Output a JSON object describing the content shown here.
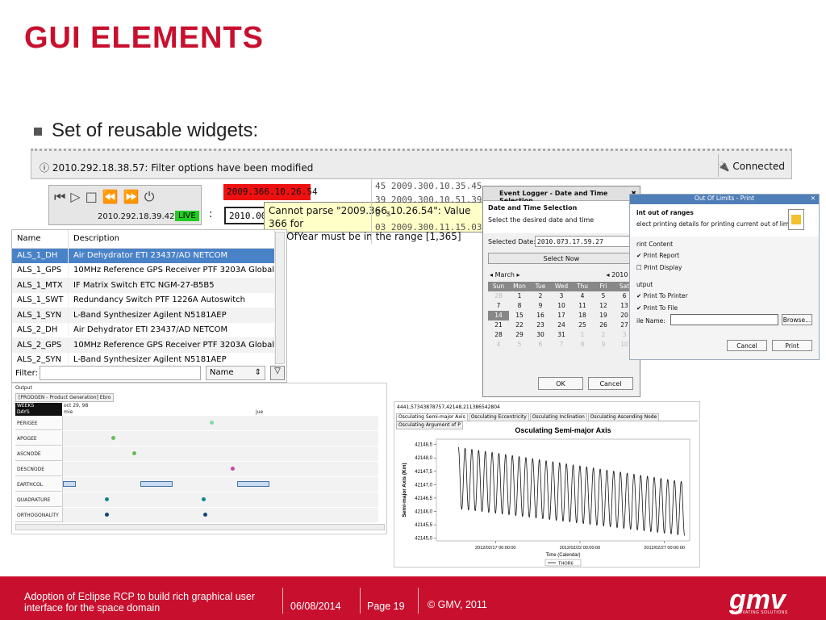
{
  "slide": {
    "title": "GUI ELEMENTS",
    "bullet": "Set of reusable widgets:"
  },
  "statusbar": {
    "message": "2010.292.18.38.57: Filter options have been modified",
    "connection": "Connected"
  },
  "player": {
    "timestamp": "2010.292.18.39.42",
    "live_label": "LIVE"
  },
  "date_widget": {
    "error_value": "2009.366.10.26.54",
    "input_value": "2010.001",
    "tooltip_line1": "Cannot parse \"2009.366.10.26.54\": Value 366 for",
    "tooltip_line2": "dayOfYear must be in the range [1,365]"
  },
  "log_list": [
    {
      "id": "45",
      "time": "2009.300.10.35.45"
    },
    {
      "id": "39",
      "time": "2009.300.10.51.39"
    },
    {
      "id": "0",
      "time": "s"
    },
    {
      "id": "03",
      "time": "2009.300.11.15.03"
    }
  ],
  "table": {
    "columns": [
      "Name",
      "Description"
    ],
    "rows": [
      {
        "name": "ALS_1_DH",
        "desc": "Air Dehydrator ETI 23437/AD NETCOM"
      },
      {
        "name": "ALS_1_GPS",
        "desc": "10MHz Reference GPS Receiver PTF 3203A Global"
      },
      {
        "name": "ALS_1_MTX",
        "desc": "IF Matrix Switch ETC NGM-27-B5B5"
      },
      {
        "name": "ALS_1_SWT",
        "desc": "Redundancy Switch PTF 1226A Autoswitch"
      },
      {
        "name": "ALS_1_SYN",
        "desc": "L-Band Synthesizer Agilent N5181AEP"
      },
      {
        "name": "ALS_2_DH",
        "desc": "Air Dehydrator ETI 23437/AD NETCOM"
      },
      {
        "name": "ALS_2_GPS",
        "desc": "10MHz Reference GPS Receiver PTF 3203A Global"
      },
      {
        "name": "ALS_2_SYN",
        "desc": "L-Band Synthesizer Agilent N5181AEP"
      }
    ],
    "filter_label": "Filter:",
    "filter_value": "",
    "filter_field": "Name"
  },
  "timeline": {
    "output_label": "Output",
    "tab_label": "[PRODGEN - Product Generation] Ebro",
    "weeks_label": "WEEKS",
    "weeks_value": "oct 29, 98",
    "days_label": "DAYS",
    "days_value1": "mie",
    "days_value2": "jue",
    "rows": [
      "PERIGEE",
      "APOGEE",
      "ASCNODE",
      "DESCNODE",
      "EARTHCOL",
      "QUADRATURE",
      "ORTHOGONALITY"
    ]
  },
  "event_dialog": {
    "window_title": "Event Logger - Date and Time Selection",
    "header_title": "Date and Time Selection",
    "header_sub": "Select the desired date and time",
    "selected_label": "Selected Date:",
    "selected_value": "2010.073.17.59.27",
    "select_now": "Select Now",
    "month": "March",
    "year": "2010",
    "weekdays": [
      "Sun",
      "Mon",
      "Tue",
      "Wed",
      "Thu",
      "Fri",
      "Sat"
    ],
    "weeks": [
      [
        "28",
        "1",
        "2",
        "3",
        "4",
        "5",
        "6"
      ],
      [
        "7",
        "8",
        "9",
        "10",
        "11",
        "12",
        "13"
      ],
      [
        "14",
        "15",
        "16",
        "17",
        "18",
        "19",
        "20"
      ],
      [
        "21",
        "22",
        "23",
        "24",
        "25",
        "26",
        "27"
      ],
      [
        "28",
        "29",
        "30",
        "31",
        "1",
        "2",
        "3"
      ],
      [
        "4",
        "5",
        "6",
        "7",
        "8",
        "9",
        "10"
      ]
    ],
    "ok": "OK",
    "cancel": "Cancel"
  },
  "print_dialog": {
    "window_title": "Out Of Limits - Print",
    "header_title": "int out of ranges",
    "header_sub": "elect printing details for printing current out of limits",
    "group_content": "rint Content",
    "print_report": "Print Report",
    "print_display": "Print Display",
    "group_output": "utput",
    "print_to_printer": "Print To Printer",
    "print_to_file": "Print To File",
    "file_name_label": "ile Name:",
    "browse": "Browse...",
    "cancel": "Cancel",
    "print": "Print"
  },
  "chart_data": {
    "type": "line",
    "header_text": "4441,57343878757,42148,211386542804",
    "tabs": [
      "Osculating Semi-major Axis",
      "Osculating Eccentricity",
      "Osculating Inclination",
      "Osculating Ascending Node",
      "Osculating Argument of P"
    ],
    "title": "Osculating Semi-major Axis",
    "ylabel": "Semi-major Axis (Km)",
    "xlabel": "Time (Calendar)",
    "yticks": [
      "42148,5",
      "42148,0",
      "42147,5",
      "42147,0",
      "42146,5",
      "42146,0",
      "42145,5",
      "42145,0"
    ],
    "xticks": [
      "2012/02/17 00:00:00",
      "2012/02/22 00:00:00",
      "2012/02/27 00:00:00"
    ],
    "ylim": [
      42144.9,
      42148.7
    ],
    "series": [
      {
        "name": "THOR6",
        "color": "#111111"
      }
    ],
    "x_start": "2012/02/13 12:00:00",
    "x_end": "2012/02/28 12:00:00",
    "oscillation_period_days": 0.4,
    "envelope": {
      "max_start": 42148.4,
      "max_end": 42147.1,
      "min_start": 42146.1,
      "min_end": 42145.1
    }
  },
  "footer": {
    "tagline": "Adoption of Eclipse RCP to build rich graphical user interface for the space domain",
    "date": "06/08/2014",
    "page": "Page 19",
    "copyright": "© GMV, 2011",
    "logo_text": "gmv",
    "logo_tag": "INNOVATING SOLUTIONS"
  }
}
